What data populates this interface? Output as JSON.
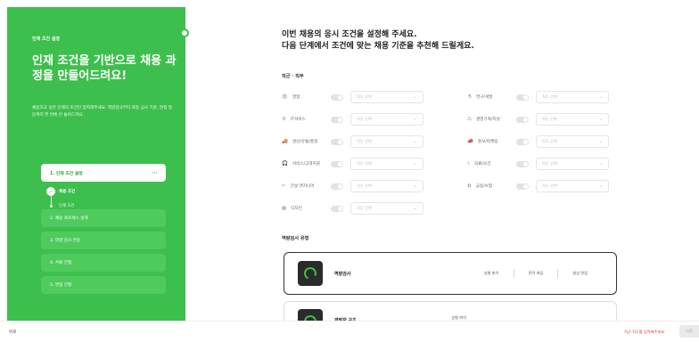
{
  "panel": {
    "step_tag": "인재 조건 설정",
    "hero": "인재 조건을 기반으로 채용 과정을 만들어드려요!",
    "description": "채용하고 싶은 인재의 조건만 입력해주세요. 역량검사부터 자동 심사 기준, 면접 질문까지 한 번에 안 들어드려요.",
    "active_step": "1. 인재 조건 설정",
    "active_step_more": "···",
    "active_sub": "채용 조건",
    "sub_item": "인재 조건",
    "steps": [
      "2. 채용 프로세스 설계",
      "3. 역량 검사 연동",
      "4. 서류 전형",
      "5. 면접 전형"
    ]
  },
  "main": {
    "title_line1": "이번 채용의 응시 조건을 설정해 주세요.",
    "title_line2": "다음 단계에서 조건에 맞는 채용 기준을 추천해 드릴게요.",
    "section_job": "직군 · 직무",
    "select_placeholder": "직무 선택",
    "left_fields": [
      {
        "label": "영업",
        "icon": "🛍"
      },
      {
        "label": "IT서비스",
        "icon": "⚙"
      },
      {
        "label": "생산/유통/품질",
        "icon": "🚚"
      },
      {
        "label": "서비스/고객지원",
        "icon": "🎧"
      },
      {
        "label": "건설 엔지니어",
        "icon": "✏"
      },
      {
        "label": "디자인",
        "icon": "▦"
      }
    ],
    "right_fields": [
      {
        "label": "연구/개발",
        "icon": "⚗"
      },
      {
        "label": "경영기획/지원",
        "icon": "⚖"
      },
      {
        "label": "홍보/마케팅",
        "icon": "📣"
      },
      {
        "label": "의료/보건",
        "icon": "⚕"
      },
      {
        "label": "금융/보험",
        "icon": "✿"
      }
    ],
    "section_test": "역량검사 유형",
    "cards": [
      {
        "title": "역량검사",
        "tags": [
          "성향 파악",
          "전략 게임",
          "영상 면접"
        ]
      },
      {
        "title": "개발자 구조",
        "tags": [
          "성향 파악"
        ]
      }
    ]
  },
  "bottom": {
    "back": "뒤로",
    "warning": "직군·직무를 입력해주세요.",
    "next": "다음"
  }
}
